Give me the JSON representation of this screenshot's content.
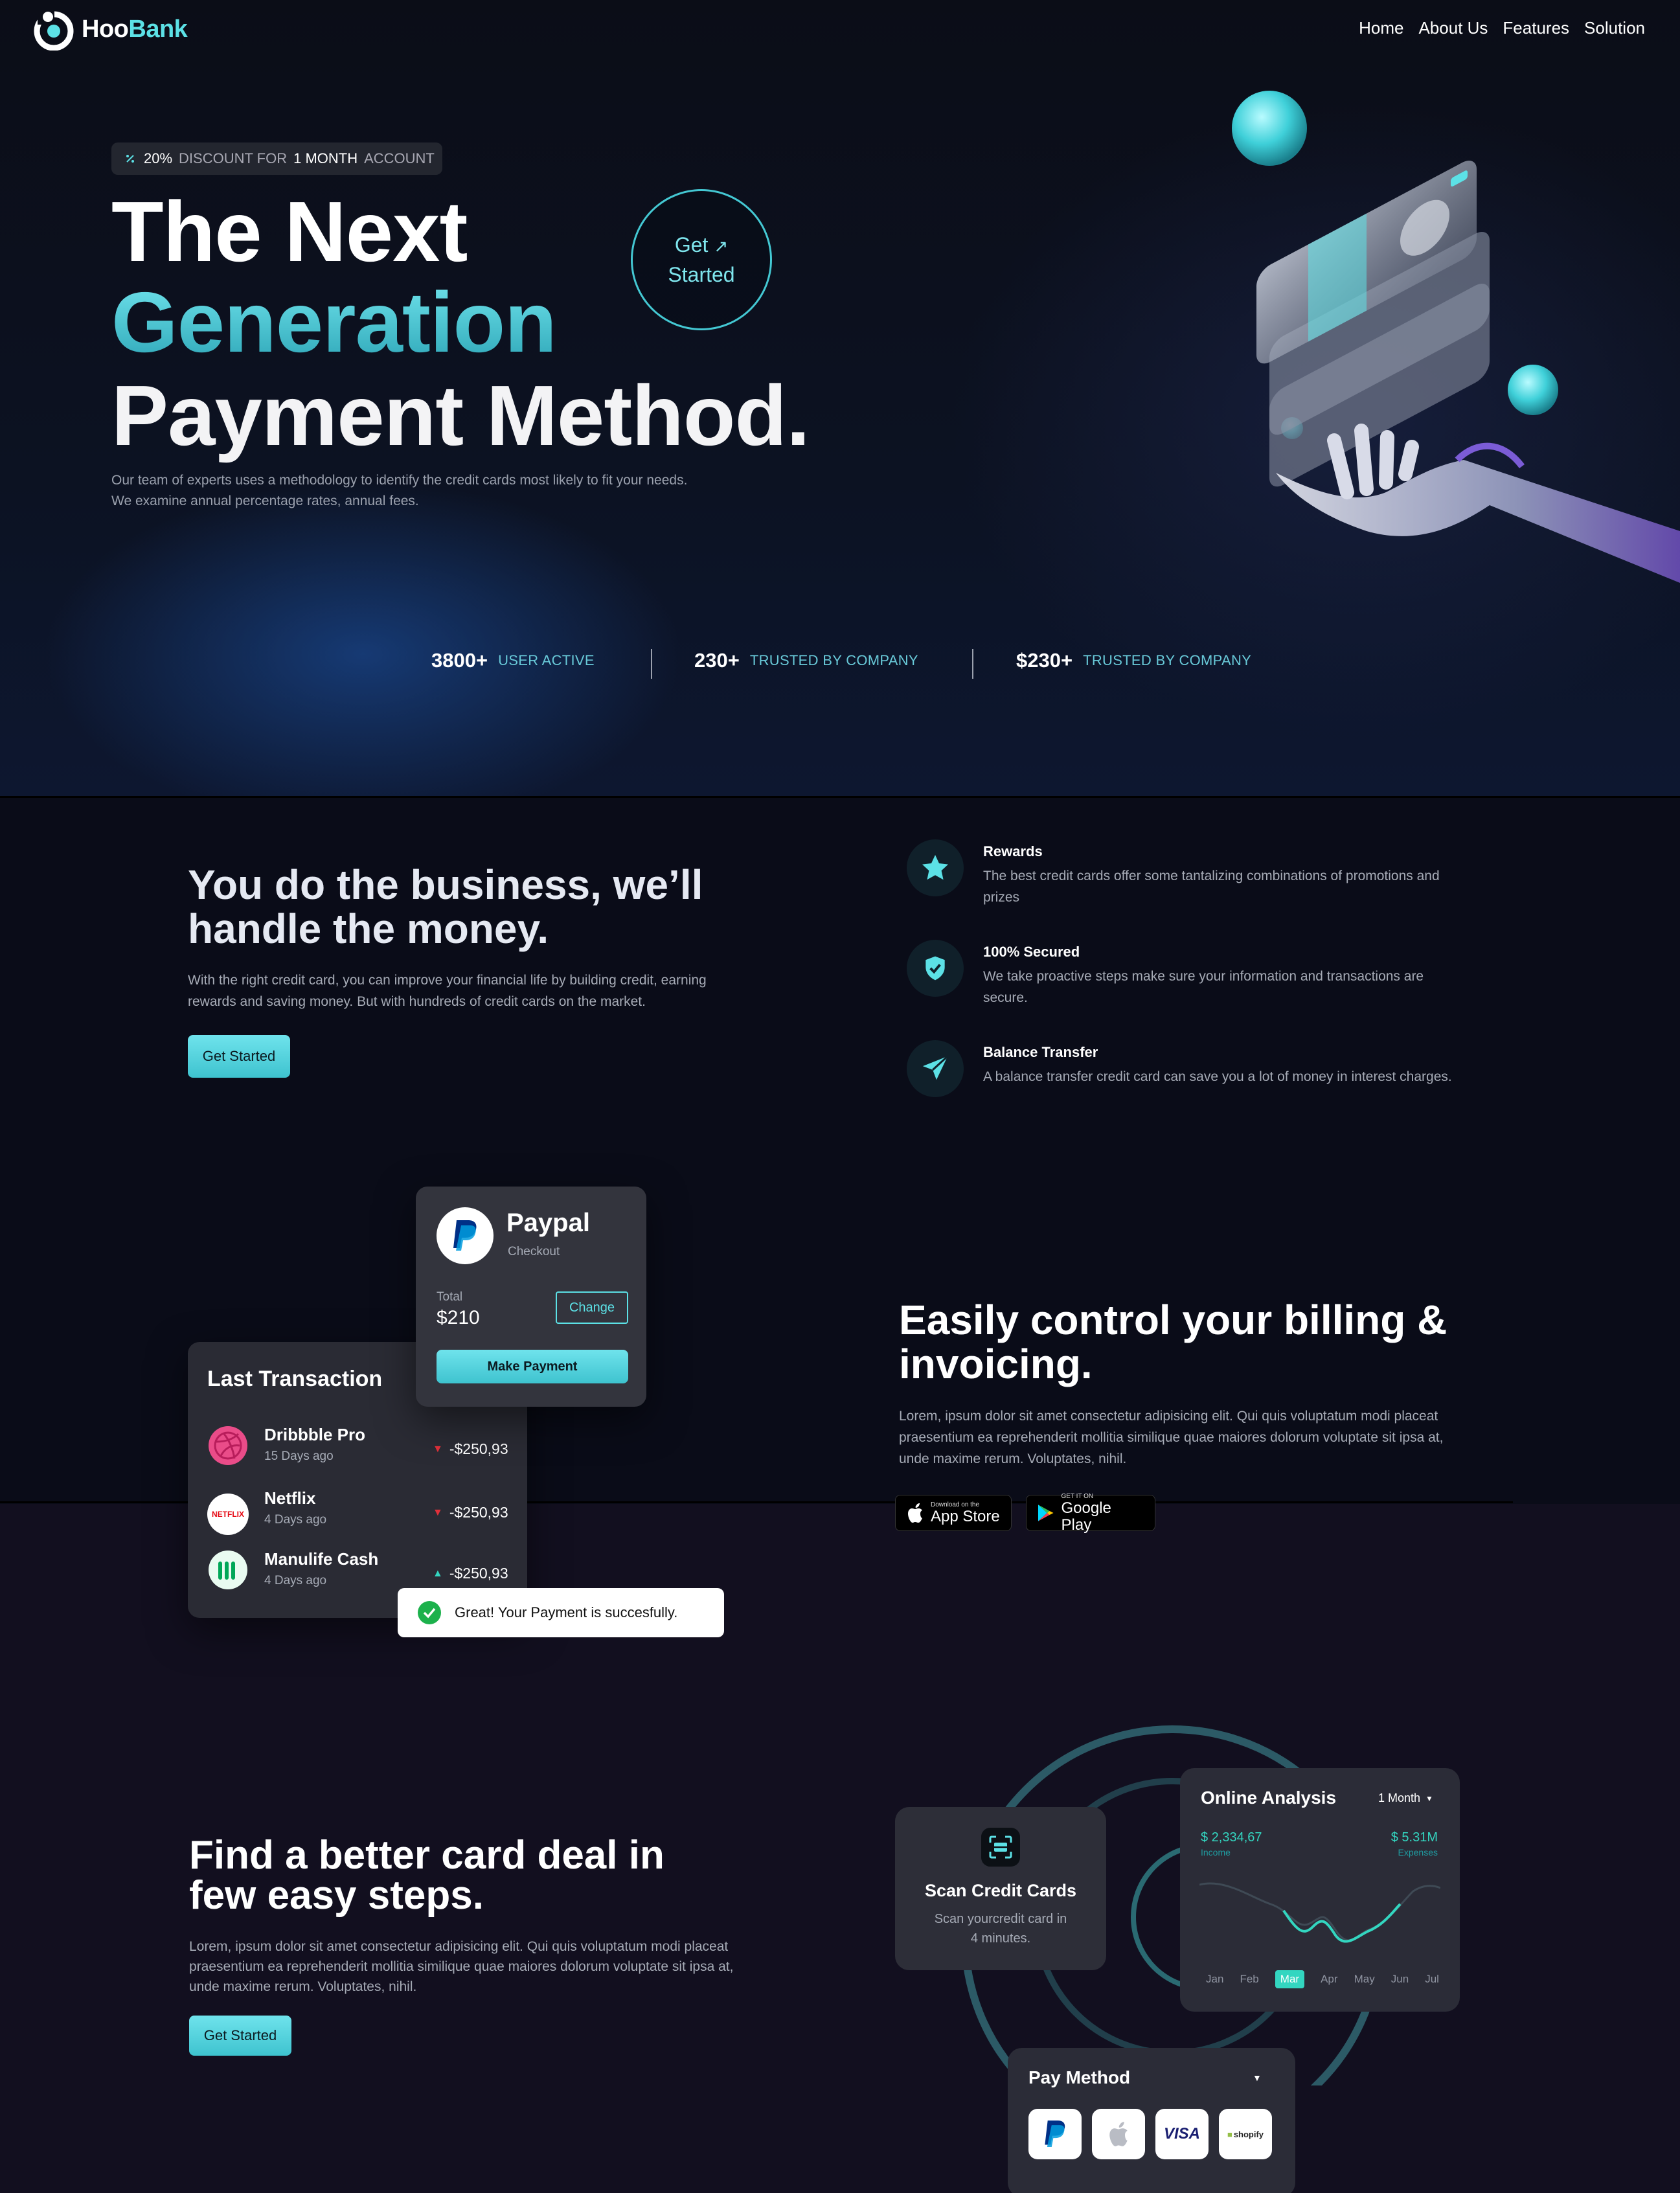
{
  "brand": {
    "name_a": "Hoo",
    "name_b": "Bank"
  },
  "nav": [
    "Home",
    "About Us",
    "Features",
    "Solution"
  ],
  "hero": {
    "badge_pct": "20%",
    "badge_mid": "DISCOUNT FOR",
    "badge_month": "1 MONTH",
    "badge_end": "ACCOUNT",
    "line1": "The Next",
    "line2": "Generation",
    "line3": "Payment Method.",
    "desc_1": "Our team of experts uses a methodology to identify the credit cards most likely to fit your needs.",
    "desc_2": "We examine annual percentage rates, annual fees.",
    "cta_1": "Get",
    "cta_2": "Started"
  },
  "stats": [
    {
      "value": "3800+",
      "label": "USER ACTIVE"
    },
    {
      "value": "230+",
      "label": "TRUSTED BY COMPANY"
    },
    {
      "value": "$230+",
      "label": "TRUSTED BY COMPANY"
    }
  ],
  "business": {
    "title_1": "You do the business, we’ll",
    "title_2": "handle the money.",
    "desc": "With the right credit card, you can improve your financial life by building credit, earning rewards and saving money. But with hundreds of credit cards on the market.",
    "cta": "Get Started"
  },
  "features": [
    {
      "icon": "star-icon",
      "title": "Rewards",
      "desc": "The best credit cards offer some tantalizing combinations of promotions and prizes"
    },
    {
      "icon": "shield-icon",
      "title": "100% Secured",
      "desc": "We take proactive steps make sure your information and transactions are secure."
    },
    {
      "icon": "send-icon",
      "title": "Balance Transfer",
      "desc": "A balance transfer credit card can save you a lot of money in interest charges."
    }
  ],
  "paypal": {
    "name": "Paypal",
    "sub": "Checkout",
    "total_label": "Total",
    "total": "$210",
    "change": "Change",
    "cta": "Make Payment"
  },
  "last_tx": {
    "title": "Last Transaction",
    "items": [
      {
        "name": "Dribbble Pro",
        "when": "15 Days ago",
        "amount": "-$250,93",
        "dir": "down"
      },
      {
        "name": "Netflix",
        "when": "4 Days ago",
        "amount": "-$250,93",
        "dir": "down"
      },
      {
        "name": "Manulife Cash",
        "when": "4 Days ago",
        "amount": "-$250,93",
        "dir": "up"
      }
    ]
  },
  "toast": "Great! Your Payment is succesfully.",
  "billing": {
    "title_1": "Easily control your billing &",
    "title_2": "invoicing.",
    "desc": "Lorem, ipsum dolor sit amet consectetur adipisicing elit. Qui quis voluptatum modi placeat praesentium ea reprehenderit mollitia similique quae maiores dolorum voluptate sit ipsa at, unde maxime rerum. Voluptates, nihil.",
    "appstore_small": "Download on the",
    "appstore_big": "App Store",
    "gplay_small": "GET IT ON",
    "gplay_big": "Google Play"
  },
  "card_deal": {
    "title_1": "Find a better card deal in",
    "title_2": "few easy steps.",
    "desc": "Lorem, ipsum dolor sit amet consectetur adipisicing elit. Qui quis voluptatum modi placeat praesentium ea reprehenderit mollitia similique quae maiores dolorum voluptate sit ipsa at, unde maxime rerum. Voluptates, nihil.",
    "cta": "Get Started"
  },
  "scan": {
    "title": "Scan Credit Cards",
    "desc_1": "Scan yourcredit card in",
    "desc_2": "4 minutes."
  },
  "analysis": {
    "title": "Online Analysis",
    "period": "1 Month",
    "income_val": "$ 2,334,67",
    "income_lbl": "Income",
    "expense_val": "$ 5.31M",
    "expense_lbl": "Expenses",
    "months": [
      "Jan",
      "Feb",
      "Mar",
      "Apr",
      "May",
      "Jun",
      "Jul"
    ],
    "active_month": "Mar"
  },
  "pay_method": {
    "title": "Pay Method",
    "options": [
      "PayPal",
      "Apple Pay",
      "VISA",
      "shopify"
    ]
  },
  "colors": {
    "accent": "#5ce1e6",
    "accent_dark": "#2fa7b8",
    "bg": "#0a0c16",
    "up": "#33d6c0",
    "down": "#e0303a"
  }
}
